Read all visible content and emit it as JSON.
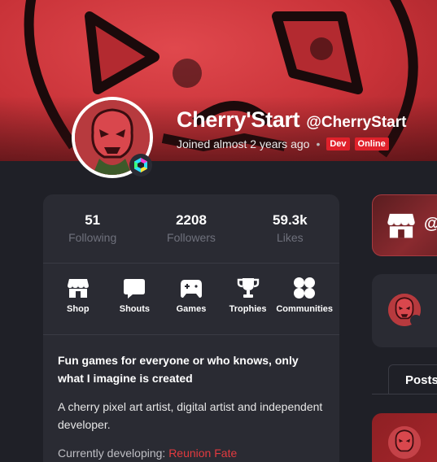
{
  "profile": {
    "display_name": "Cherry'Start",
    "handle": "@CherryStart",
    "joined": "Joined almost 2 years ago",
    "separator": "•",
    "badges": {
      "dev": "Dev",
      "online": "Online"
    }
  },
  "stats": [
    {
      "value": "51",
      "label": "Following"
    },
    {
      "value": "2208",
      "label": "Followers"
    },
    {
      "value": "59.3k",
      "label": "Likes"
    }
  ],
  "nav": [
    {
      "label": "Shop",
      "icon": "shop-icon"
    },
    {
      "label": "Shouts",
      "icon": "speech-bubble-icon"
    },
    {
      "label": "Games",
      "icon": "gamepad-icon"
    },
    {
      "label": "Trophies",
      "icon": "trophy-icon"
    },
    {
      "label": "Communities",
      "icon": "communities-icon"
    }
  ],
  "bio": {
    "headline": "Fun games for everyone or who knows, only what I imagine is created",
    "text": "A cherry pixel art artist, digital artist and independent developer.",
    "developing_label": "Currently developing: ",
    "developing_link": "Reunion Fate"
  },
  "right": {
    "shop_at": "@",
    "posts_tab": "Posts"
  },
  "colors": {
    "accent": "#e23a3f",
    "background": "#1f2027",
    "card": "#2a2b33",
    "badge": "#e0212b"
  }
}
